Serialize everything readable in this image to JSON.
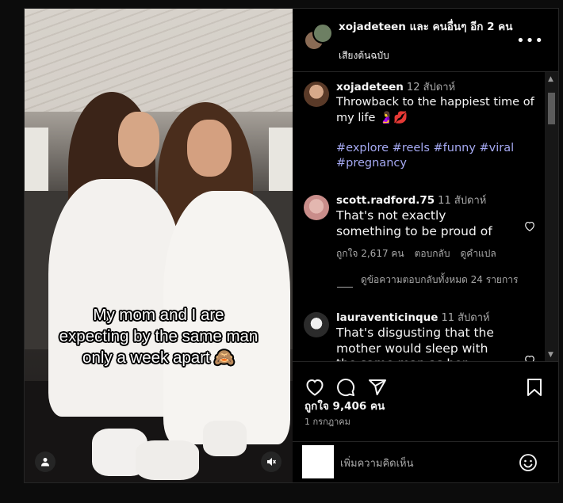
{
  "header": {
    "title": "xojadeteen และ คนอื่นๆ อีก 2 คน",
    "audio": "เสียงต้นฉบับ",
    "more_label": "•••"
  },
  "media": {
    "overlay_lines": [
      "My mom and I are",
      "expecting by the same man",
      "only a week apart 🙈"
    ]
  },
  "caption": {
    "username": "xojadeteen",
    "time": "12 สัปดาห์",
    "text": "Throwback to the happiest time of my life 🤰💋",
    "tags": "#explore #reels #funny #viral #pregnancy"
  },
  "comments": [
    {
      "username": "scott.radford.75",
      "time": "11 สัปดาห์",
      "text": "That's not exactly something to be proud of",
      "likes": "ถูกใจ 2,617 คน",
      "reply": "ตอบกลับ",
      "translate": "ดูคำแปล"
    },
    {
      "username": "lauraventicinque",
      "time": "11 สัปดาห์",
      "text": "That's disgusting that the mother would sleep with the same man as her"
    }
  ],
  "view_replies": "ดูข้อความตอบกลับทั้งหมด 24 รายการ",
  "footer": {
    "likes": "ถูกใจ 9,406 คน",
    "date": "1 กรกฎาคม",
    "add_comment_placeholder": "เพิ่มความคิดเห็น"
  },
  "colors": {
    "background": "#000000",
    "link_hashtag": "#a5a9f2",
    "secondary_text": "#a8a8a8",
    "divider": "#262626"
  },
  "icons": [
    "heart-icon",
    "comment-icon",
    "share-icon",
    "bookmark-icon",
    "emoji-icon",
    "user-tag-icon",
    "mute-icon",
    "more-icon"
  ]
}
